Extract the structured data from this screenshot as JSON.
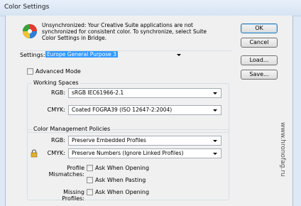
{
  "window": {
    "title": "Color Settings"
  },
  "message": "Unsynchronized: Your Creative Suite applications are not synchronized for consistent color. To synchronize, select Suite Color Settings in Bridge.",
  "buttons": {
    "ok": "OK",
    "cancel": "Cancel",
    "load": "Load...",
    "save": "Save..."
  },
  "settings": {
    "label": "Settings:",
    "value": "Europe General Purpose 3"
  },
  "advanced_mode": {
    "label": "Advanced Mode",
    "checked": false
  },
  "working_spaces": {
    "title": "Working Spaces",
    "rgb_label": "RGB:",
    "rgb_value": "sRGB IEC61966-2.1",
    "cmyk_label": "CMYK:",
    "cmyk_value": "Coated FOGRA39 (ISO 12647-2:2004)"
  },
  "policies": {
    "title": "Color Management Policies",
    "rgb_label": "RGB:",
    "rgb_value": "Preserve Embedded Profiles",
    "cmyk_label": "CMYK:",
    "cmyk_value": "Preserve Numbers (Ignore Linked Profiles)",
    "mismatch_label": "Profile Mismatches:",
    "ask_opening": "Ask When Opening",
    "ask_pasting": "Ask When Pasting",
    "missing_label": "Missing Profiles:",
    "missing_ask_opening": "Ask When Opening"
  },
  "watermark": "www.hronofag.ru",
  "colors": {
    "selection": "#3399ff",
    "dialog_bg": "#f0f0f0",
    "titlebar": "#dfe9f5"
  }
}
